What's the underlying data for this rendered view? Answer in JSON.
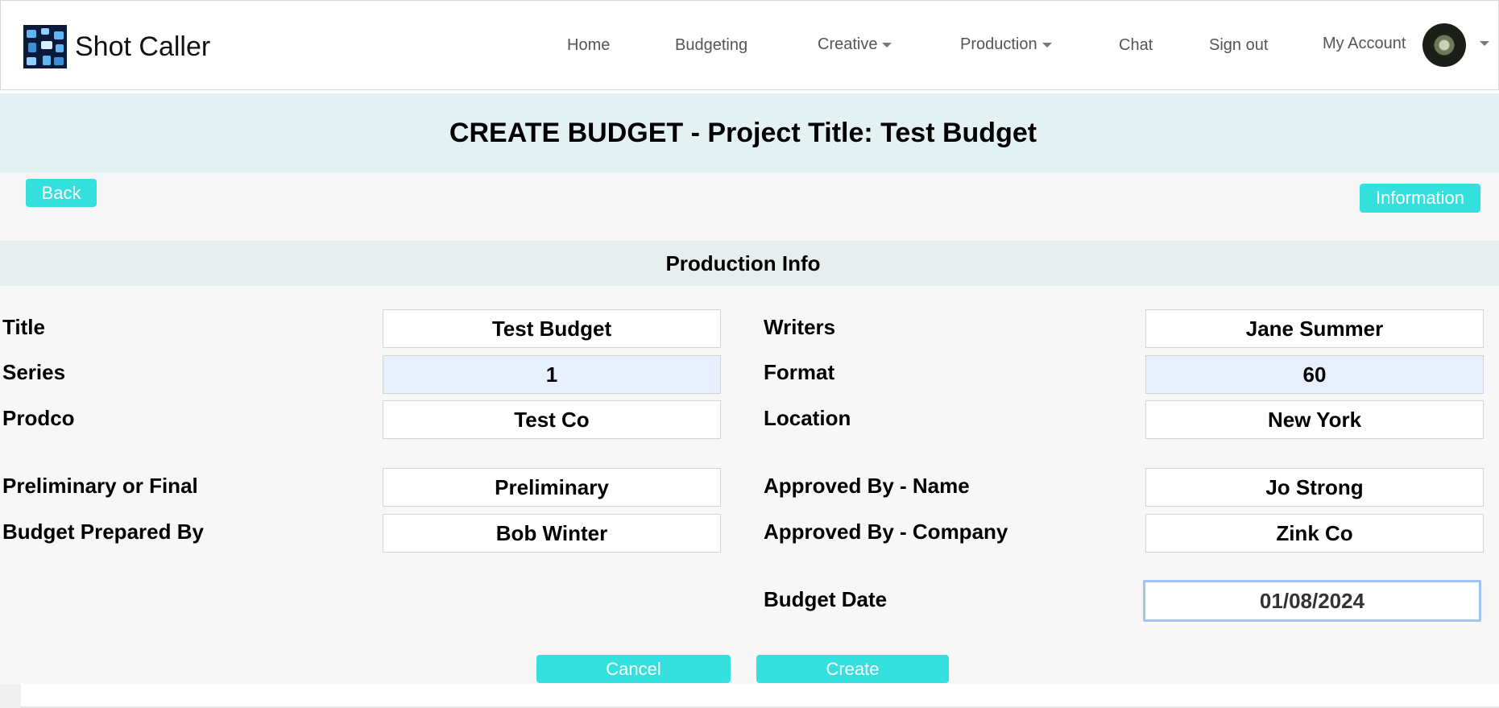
{
  "nav": {
    "brand": "Shot Caller",
    "items": [
      {
        "label": "Home"
      },
      {
        "label": "Budgeting"
      },
      {
        "label": "Creative"
      },
      {
        "label": "Production"
      },
      {
        "label": "Chat"
      },
      {
        "label": "Sign out"
      }
    ],
    "account_label": "My Account"
  },
  "page": {
    "title": "CREATE BUDGET - Project Title: Test Budget",
    "back_label": "Back",
    "info_label": "Information"
  },
  "section": {
    "title": "Production Info"
  },
  "form": {
    "title_label": "Title",
    "title_value": "Test Budget",
    "series_label": "Series",
    "series_value": "1",
    "prodco_label": "Prodco",
    "prodco_value": "Test Co",
    "prelim_label": "Preliminary or Final",
    "prelim_value": "Preliminary",
    "prepared_label": "Budget Prepared By",
    "prepared_value": "Bob Winter",
    "writers_label": "Writers",
    "writers_value": "Jane Summer",
    "format_label": "Format",
    "format_value": "60",
    "location_label": "Location",
    "location_value": "New York",
    "approved_name_label": "Approved By - Name",
    "approved_name_value": "Jo Strong",
    "approved_company_label": "Approved By - Company",
    "approved_company_value": "Zink Co",
    "budget_date_label": "Budget Date",
    "budget_date_value": "01/08/2024"
  },
  "actions": {
    "cancel_label": "Cancel",
    "create_label": "Create"
  },
  "colors": {
    "accent": "#34e0de",
    "title_band": "#e4f1f2",
    "section_band": "#e6eeee",
    "autofill": "#e8f0fe"
  }
}
